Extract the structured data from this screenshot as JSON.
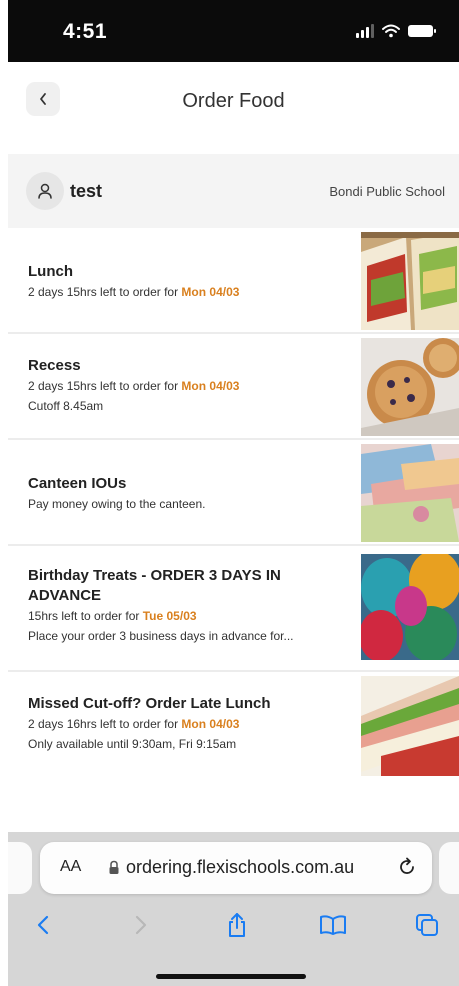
{
  "status_bar": {
    "time": "4:51"
  },
  "header": {
    "title": "Order Food"
  },
  "profile": {
    "name": "test",
    "school": "Bondi Public School"
  },
  "menu_items": [
    {
      "title": "Lunch",
      "lines": [
        {
          "text": "2 days 15hrs left to order for ",
          "date": "Mon 04/03"
        }
      ],
      "image": "sandwich-image"
    },
    {
      "title": "Recess",
      "lines": [
        {
          "text": "2 days 15hrs left to order for ",
          "date": "Mon 04/03"
        },
        {
          "text": "Cutoff 8.45am"
        }
      ],
      "image": "muffin-image"
    },
    {
      "title": "Canteen IOUs",
      "lines": [
        {
          "text": "Pay money owing to the canteen."
        }
      ],
      "image": "money-image"
    },
    {
      "title": "Birthday Treats - ORDER 3 DAYS IN ADVANCE",
      "lines": [
        {
          "text": "15hrs left to order for ",
          "date": "Tue 05/03"
        },
        {
          "text": "Place your order 3 business days in advance for..."
        }
      ],
      "image": "balloons-image"
    },
    {
      "title": "Missed Cut-off? Order Late Lunch",
      "lines": [
        {
          "text": "2 days 16hrs left to order for ",
          "date": "Mon 04/03"
        },
        {
          "text": "Only available until 9:30am, Fri 9:15am"
        }
      ],
      "image": "wrap-image"
    }
  ],
  "browser": {
    "aa_label": "AA",
    "url": "ordering.flexischools.com.au"
  },
  "colors": {
    "accent_date": "#d9801f",
    "ios_blue": "#1a7cf2",
    "browser_bg": "#d6d6d6"
  }
}
